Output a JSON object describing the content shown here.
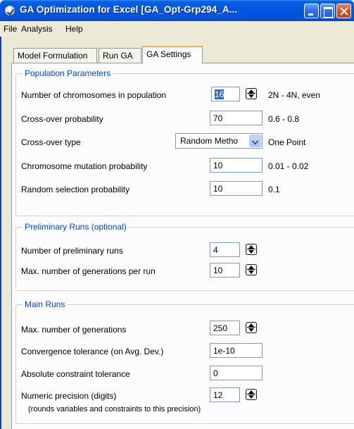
{
  "window": {
    "title": "GA Optimization for Excel [GA_Opt-Grp294_A..."
  },
  "menu": {
    "file": "File",
    "analysis": "Analysis",
    "help": "Help"
  },
  "tabs": [
    {
      "label": "Model Formulation"
    },
    {
      "label": "Run GA"
    },
    {
      "label": "GA Settings"
    }
  ],
  "population": {
    "title": "Population Parameters",
    "chromosomes_label": "Number of chromosomes in population",
    "chromosomes_value": "16",
    "chromosomes_hint": "2N - 4N, even",
    "crossover_prob_label": "Cross-over probability",
    "crossover_prob_value": "70",
    "crossover_prob_hint": "0.6 - 0.8",
    "crossover_type_label": "Cross-over type",
    "crossover_type_value": "Random Metho",
    "crossover_type_hint": "One Point",
    "mutation_label": "Chromosome mutation probability",
    "mutation_value": "10",
    "mutation_hint": "0.01 - 0.02",
    "random_sel_label": "Random selection probability",
    "random_sel_value": "10",
    "random_sel_hint": "0.1"
  },
  "preliminary": {
    "title": "Preliminary Runs (optional)",
    "runs_label": "Number of preliminary runs",
    "runs_value": "4",
    "gens_label": "Max. number of generations per run",
    "gens_value": "10"
  },
  "main_runs": {
    "title": "Main Runs",
    "max_gens_label": "Max. number of generations",
    "max_gens_value": "250",
    "conv_tol_label": "Convergence tolerance (on Avg. Dev.)",
    "conv_tol_value": "1e-10",
    "abs_tol_label": "Absolute constraint tolerance",
    "abs_tol_value": "0",
    "precision_label": "Numeric precision (digits)",
    "precision_value": "12",
    "precision_note": "(rounds variables and constraints to this precision)"
  },
  "colors": {
    "titlebar": "#0454df",
    "group_title": "#0046d5",
    "selection": "#316ac5"
  }
}
